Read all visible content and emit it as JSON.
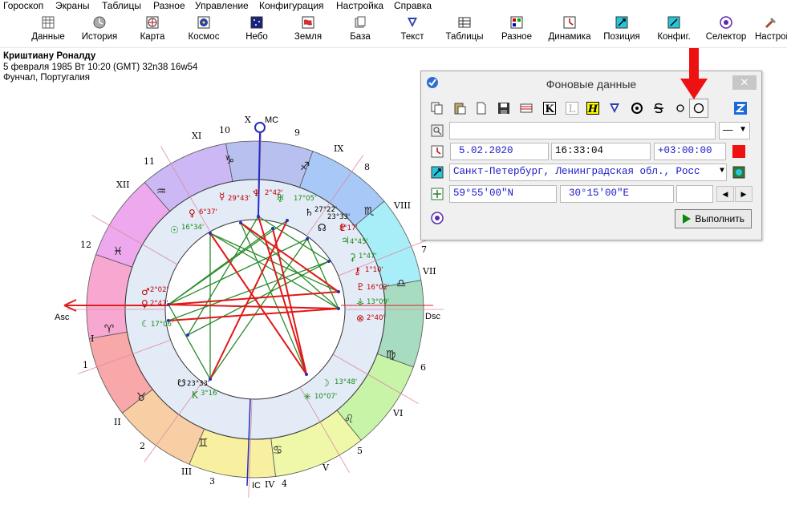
{
  "menu": [
    "Гороскоп",
    "Экраны",
    "Таблицы",
    "Разное",
    "Управление",
    "Конфигурация",
    "Настройка",
    "Справка"
  ],
  "toolbar": [
    {
      "label": "Данные",
      "icon": "data-icon"
    },
    {
      "label": "История",
      "icon": "history-icon"
    },
    {
      "label": "Карта",
      "icon": "map-icon"
    },
    {
      "label": "Космос",
      "icon": "cosmos-icon"
    },
    {
      "label": "Небо",
      "icon": "sky-icon"
    },
    {
      "label": "Земля",
      "icon": "earth-icon"
    },
    {
      "label": "База",
      "icon": "database-icon"
    },
    {
      "label": "Текст",
      "icon": "text-icon"
    },
    {
      "label": "Таблицы",
      "icon": "tables-icon"
    },
    {
      "label": "Разное",
      "icon": "misc-icon"
    },
    {
      "label": "Динамика",
      "icon": "dynamics-icon"
    },
    {
      "label": "Позиция",
      "icon": "position-icon"
    },
    {
      "label": "Конфиг.",
      "icon": "config-icon"
    },
    {
      "label": "Селектор",
      "icon": "selector-icon"
    },
    {
      "label": "Настрой",
      "icon": "settings-icon"
    }
  ],
  "person": {
    "name": "Криштиану Роналду",
    "line2": "5 февраля 1985  Вт  10:20 (GMT) 32n38  16w54",
    "line3": "Фунчал, Португалия"
  },
  "wheel": {
    "axes": {
      "mc": "MC",
      "ic": "IC",
      "asc": "Asc",
      "dsc": "Dsc"
    },
    "houses": [
      "1",
      "2",
      "3",
      "4",
      "5",
      "6",
      "7",
      "8",
      "9",
      "10",
      "11",
      "12"
    ],
    "romans": [
      "I",
      "II",
      "III",
      "IV",
      "V",
      "VI",
      "VII",
      "VIII",
      "IX",
      "X",
      "XI",
      "XII"
    ],
    "signs": [
      "♈",
      "♉",
      "♊",
      "♋",
      "♌",
      "♍",
      "♎",
      "♏",
      "♐",
      "♑",
      "♒",
      "♓"
    ],
    "inner_labels": [
      {
        "text": "2°42'",
        "color": "#c00000"
      },
      {
        "text": "29°43'",
        "color": "#c00000"
      },
      {
        "text": "17°05'",
        "color": "#1a8a1a"
      },
      {
        "text": "27°22'",
        "color": "#000000"
      },
      {
        "text": "23°33'",
        "color": "#000000"
      },
      {
        "text": "6°37'",
        "color": "#c00000"
      },
      {
        "text": "16°34'",
        "color": "#1a8a1a"
      },
      {
        "text": "8°17'",
        "color": "#c00000"
      },
      {
        "text": "4°45'",
        "color": "#1a8a1a"
      },
      {
        "text": "1°47'",
        "color": "#1a8a1a"
      },
      {
        "text": "1°10'",
        "color": "#c00000"
      },
      {
        "text": "16°02'",
        "color": "#c00000"
      },
      {
        "text": "13°09'",
        "color": "#1a8a1a"
      },
      {
        "text": "2°40'",
        "color": "#c00000"
      },
      {
        "text": "2°02'",
        "color": "#c00000"
      },
      {
        "text": "2°47'",
        "color": "#c00000"
      },
      {
        "text": "17°06'",
        "color": "#1a8a1a"
      },
      {
        "text": "23°33'",
        "color": "#000000"
      },
      {
        "text": "3°16'",
        "color": "#1a8a1a"
      },
      {
        "text": "13°48'",
        "color": "#1a8a1a"
      },
      {
        "text": "10°07'",
        "color": "#1a8a1a"
      }
    ]
  },
  "dialog": {
    "title": "Фоновые данные",
    "close": "✕",
    "date": "5.02.2020",
    "time": "16:33:04",
    "tz": "+03:00:00",
    "place": "Санкт-Петербург, Ленинградская обл., Росс",
    "lat": "59°55'00\"N",
    "lon": "30°15'00\"E",
    "select_value": "—",
    "execute": "Выполнить",
    "accent_color": "#ee1111"
  }
}
